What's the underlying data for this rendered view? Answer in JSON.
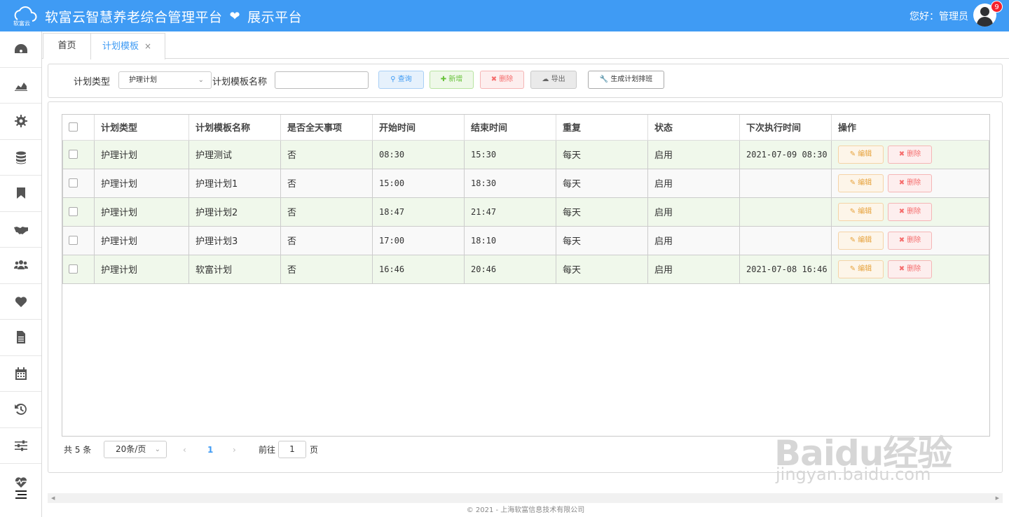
{
  "header": {
    "logo_text": "软富云",
    "title": "软富云智慧养老综合管理平台",
    "subtitle": "展示平台",
    "greeting": "您好：管理员",
    "badge_count": "9"
  },
  "sidebar": {
    "icons": [
      "dashboard-icon",
      "chart-icon",
      "gear-icon",
      "database-icon",
      "bookmark-icon",
      "handshake-icon",
      "users-icon",
      "heart-icon",
      "document-icon",
      "calendar-icon",
      "history-icon",
      "sliders-icon",
      "heartbeat-icon"
    ]
  },
  "tabs": {
    "home": "首页",
    "active": "计划模板",
    "close": "×"
  },
  "search": {
    "type_label": "计划类型",
    "type_value": "护理计划",
    "name_label": "计划模板名称",
    "name_value": "",
    "query_label": "查询",
    "add_label": "新增",
    "delete_label": "删除",
    "export_label": "导出",
    "generate_label": "生成计划排班"
  },
  "table": {
    "headers": [
      "计划类型",
      "计划模板名称",
      "是否全天事项",
      "开始时间",
      "结束时间",
      "重复",
      "状态",
      "下次执行时间",
      "操作"
    ],
    "rows": [
      [
        "护理计划",
        "护理测试",
        "否",
        "08:30",
        "15:30",
        "每天",
        "启用",
        "2021-07-09 08:30"
      ],
      [
        "护理计划",
        "护理计划1",
        "否",
        "15:00",
        "18:30",
        "每天",
        "启用",
        ""
      ],
      [
        "护理计划",
        "护理计划2",
        "否",
        "18:47",
        "21:47",
        "每天",
        "启用",
        ""
      ],
      [
        "护理计划",
        "护理计划3",
        "否",
        "17:00",
        "18:10",
        "每天",
        "启用",
        ""
      ],
      [
        "护理计划",
        "软富计划",
        "否",
        "16:46",
        "20:46",
        "每天",
        "启用",
        "2021-07-08 16:46"
      ]
    ],
    "edit_label": "编辑",
    "delete_label": "删除"
  },
  "pager": {
    "total": "共 5 条",
    "page_size": "20条/页",
    "prev": "‹",
    "current": "1",
    "next": "›",
    "goto_label": "前往",
    "goto_value": "1",
    "page_suffix": "页"
  },
  "footer": {
    "text": "© 2021 - 上海软富信息技术有限公司"
  },
  "watermark": {
    "brand": "Baidu经验",
    "url": "jingyan.baidu.com"
  },
  "colors": {
    "header_bg": "#3f9bf4",
    "row_odd": "#f0f8eb",
    "edit": "#e6a23c",
    "danger": "#f56c6c",
    "success": "#67c23a"
  }
}
